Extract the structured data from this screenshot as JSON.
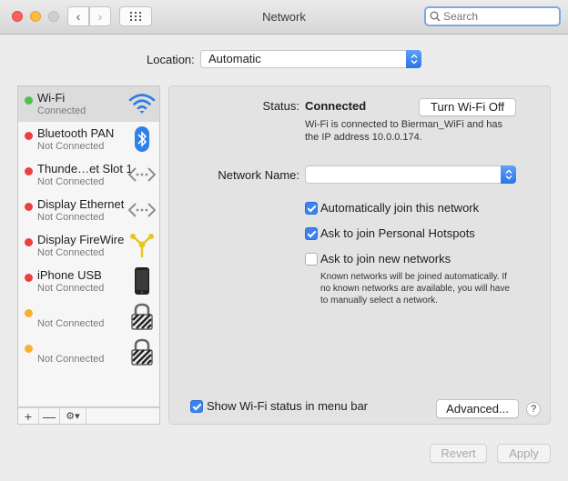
{
  "window": {
    "title": "Network"
  },
  "search": {
    "placeholder": "Search"
  },
  "location": {
    "label": "Location:",
    "value": "Automatic"
  },
  "services": [
    {
      "name": "Wi-Fi",
      "status": "Connected",
      "dot": "green",
      "icon": "wifi-icon",
      "selected": true
    },
    {
      "name": "Bluetooth PAN",
      "status": "Not Connected",
      "dot": "red",
      "icon": "bluetooth-icon"
    },
    {
      "name": "Thunde…et Slot 1",
      "status": "Not Connected",
      "dot": "red",
      "icon": "ethernet-arrows-icon"
    },
    {
      "name": "Display Ethernet",
      "status": "Not Connected",
      "dot": "red",
      "icon": "ethernet-arrows-icon"
    },
    {
      "name": "Display FireWire",
      "status": "Not Connected",
      "dot": "red",
      "icon": "firewire-icon"
    },
    {
      "name": "iPhone USB",
      "status": "Not Connected",
      "dot": "red",
      "icon": "iphone-icon"
    },
    {
      "name": "",
      "status": "Not Connected",
      "dot": "yellow",
      "icon": "vpn-lock-icon"
    },
    {
      "name": "",
      "status": "Not Connected",
      "dot": "yellow",
      "icon": "vpn-lock-icon"
    }
  ],
  "sidebar_controls": {
    "add": "+",
    "remove": "—",
    "action": "⚙▾"
  },
  "detail": {
    "status_label": "Status:",
    "status_value": "Connected",
    "toggle_button": "Turn Wi-Fi Off",
    "status_desc_1": "Wi-Fi is connected to Bierman_WiFi and has",
    "status_desc_2": "the IP address 10.0.0.174.",
    "network_name_label": "Network Name:",
    "network_name_value": "",
    "auto_join": {
      "label": "Automatically join this network",
      "checked": true
    },
    "ask_hotspots": {
      "label": "Ask to join Personal Hotspots",
      "checked": true
    },
    "ask_new": {
      "label": "Ask to join new networks",
      "checked": false
    },
    "note_1": "Known networks will be joined automatically. If",
    "note_2": "no known networks are available, you will have",
    "note_3": "to manually select a network.",
    "show_status": {
      "label": "Show Wi-Fi status in menu bar",
      "checked": true
    },
    "advanced_button": "Advanced...",
    "help": "?"
  },
  "footer": {
    "revert": "Revert",
    "apply": "Apply"
  },
  "colors": {
    "accent": "#3b82f2",
    "connected": "#4cc34c",
    "disconnected": "#e94040",
    "inactive": "#f5b32c"
  }
}
